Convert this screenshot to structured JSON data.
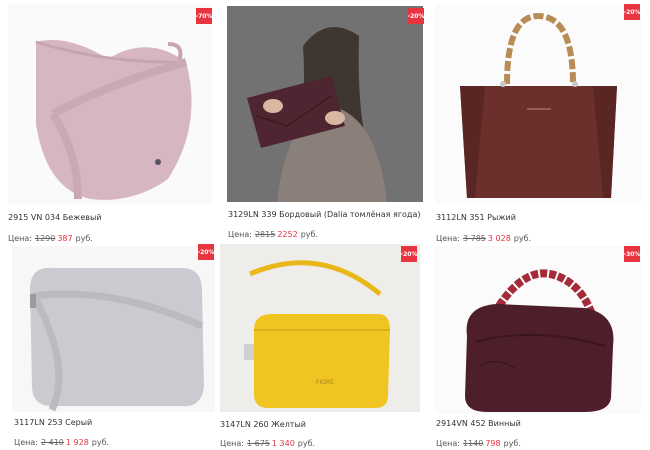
{
  "currency_prefix": "Цена:",
  "currency_suffix": "руб.",
  "products": [
    {
      "name": "2915 VN 034 Бежевый",
      "discount": "-70%",
      "old_price": "1290",
      "new_price": "387",
      "color": "#d9b9c3"
    },
    {
      "name": "3129LN 339 Бордовый (Dalia томлёная ягода)",
      "discount": "-20%",
      "old_price": "2815",
      "new_price": "2252",
      "color": "#5a2a33"
    },
    {
      "name": "3112LN 351 Рыжий",
      "discount": "-20%",
      "old_price": "3 785",
      "new_price": "3 028",
      "color": "#6b2f2c"
    },
    {
      "name": "3117LN 253 Серый",
      "discount": "-20%",
      "old_price": "2 410",
      "new_price": "1 928",
      "color": "#c9cbd0"
    },
    {
      "name": "3147LN 260 Желтый",
      "discount": "-20%",
      "old_price": "1 675",
      "new_price": "1 340",
      "color": "#f0c521"
    },
    {
      "name": "2914VN 452 Винный",
      "discount": "-30%",
      "old_price": "1140",
      "new_price": "798",
      "color": "#4e1e2a"
    }
  ],
  "brand_mark": "FIORE"
}
